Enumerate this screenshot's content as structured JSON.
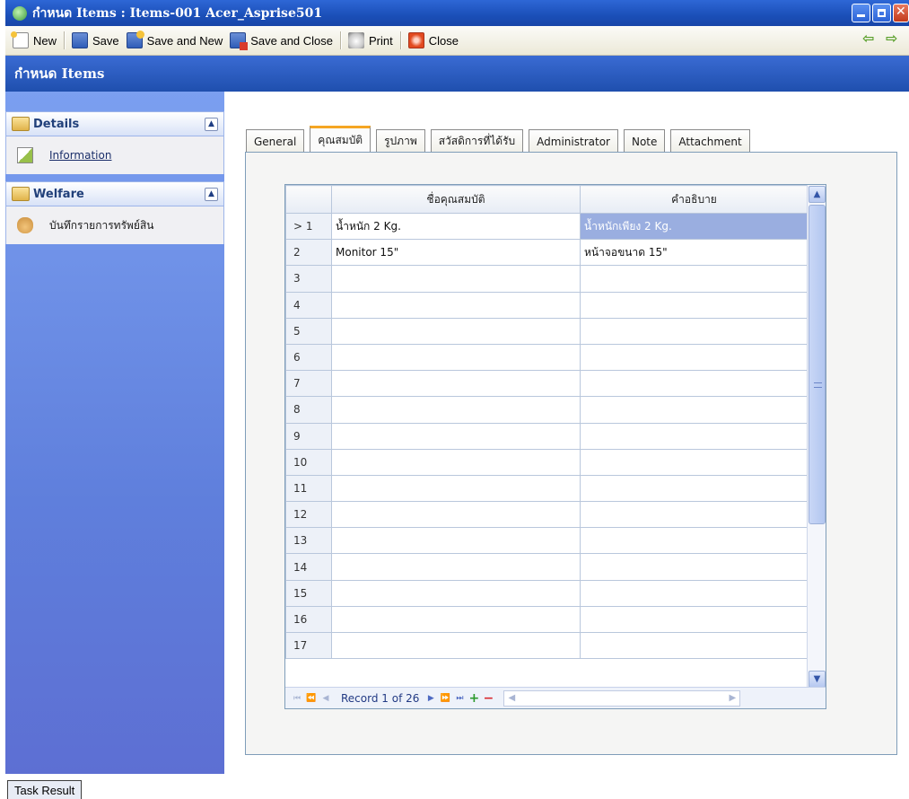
{
  "window": {
    "title": "กำหนด Items : Items-001 Acer_Asprise501"
  },
  "toolbar": {
    "new_label": "New",
    "save_label": "Save",
    "save_new_label": "Save and New",
    "save_close_label": "Save and Close",
    "print_label": "Print",
    "close_label": "Close"
  },
  "page": {
    "heading": "กำหนด Items"
  },
  "sidebar": {
    "groups": [
      {
        "title": "Details",
        "items": [
          {
            "label": "Information",
            "icon": "edit-note-icon"
          }
        ]
      },
      {
        "title": "Welfare",
        "items": [
          {
            "label": "บันทึกรายการทรัพย์สิน",
            "icon": "hand-pointer-icon"
          }
        ]
      }
    ]
  },
  "tabs": [
    {
      "label": "General"
    },
    {
      "label": "คุณสมบัติ",
      "active": true
    },
    {
      "label": "รูปภาพ"
    },
    {
      "label": "สวัสดิการที่ได้รับ"
    },
    {
      "label": "Administrator"
    },
    {
      "label": "Note"
    },
    {
      "label": "Attachment"
    }
  ],
  "grid": {
    "columns": {
      "row": "",
      "name": "ชื่อคุณสมบัติ",
      "desc": "คำอธิบาย"
    },
    "rows": [
      {
        "num": "> 1",
        "name": "น้ำหนัก 2 Kg.",
        "desc": "น้ำหนักเพียง 2 Kg."
      },
      {
        "num": "2",
        "name": "Monitor 15\"",
        "desc": "หน้าจอขนาด 15\""
      },
      {
        "num": "3",
        "name": "",
        "desc": ""
      },
      {
        "num": "4",
        "name": "",
        "desc": ""
      },
      {
        "num": "5",
        "name": "",
        "desc": ""
      },
      {
        "num": "6",
        "name": "",
        "desc": ""
      },
      {
        "num": "7",
        "name": "",
        "desc": ""
      },
      {
        "num": "8",
        "name": "",
        "desc": ""
      },
      {
        "num": "9",
        "name": "",
        "desc": ""
      },
      {
        "num": "10",
        "name": "",
        "desc": ""
      },
      {
        "num": "11",
        "name": "",
        "desc": ""
      },
      {
        "num": "12",
        "name": "",
        "desc": ""
      },
      {
        "num": "13",
        "name": "",
        "desc": ""
      },
      {
        "num": "14",
        "name": "",
        "desc": ""
      },
      {
        "num": "15",
        "name": "",
        "desc": ""
      },
      {
        "num": "16",
        "name": "",
        "desc": ""
      },
      {
        "num": "17",
        "name": "",
        "desc": ""
      }
    ],
    "record_text": "Record 1 of 26"
  },
  "footer": {
    "task_result_label": "Task Result"
  },
  "colors": {
    "titlebar": "#1b4fb8",
    "sidebar": "#6e8fe6",
    "tab_accent": "#f5a623",
    "selected_cell": "#9aaee0"
  }
}
